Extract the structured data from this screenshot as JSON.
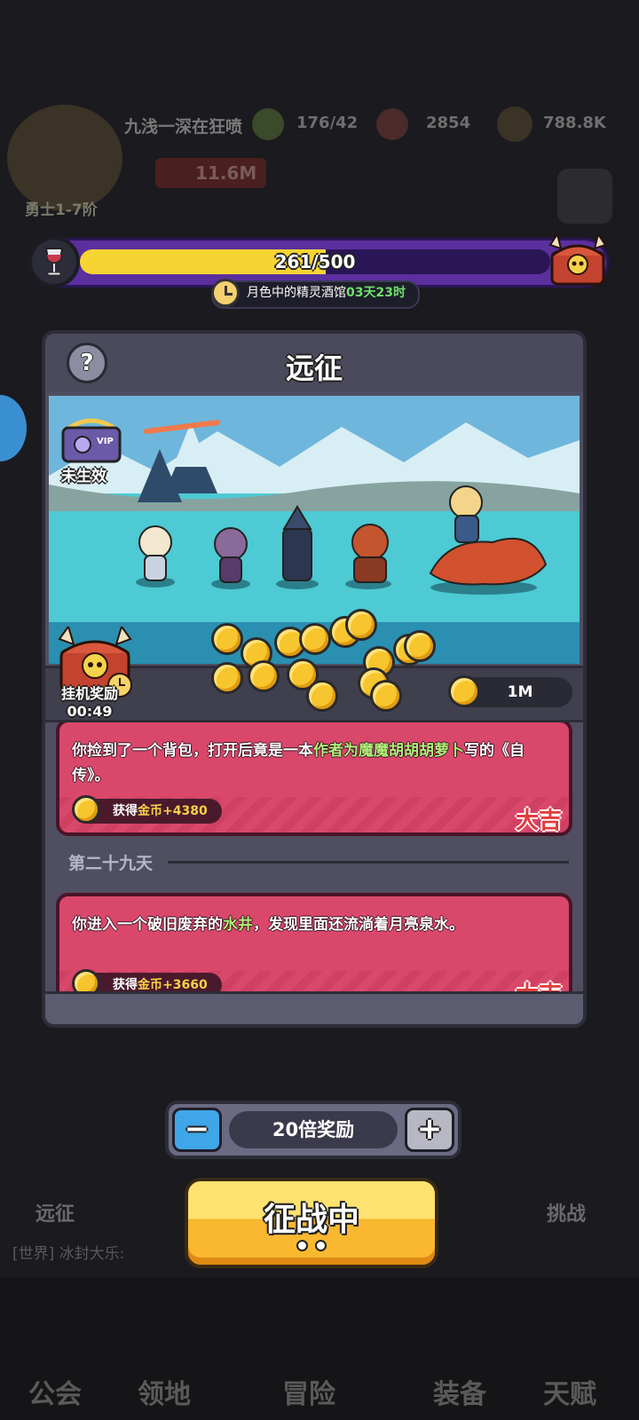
{
  "background": {
    "player_name": "九浅一深在狂喷",
    "resource_1": "176/42",
    "resource_2": "2854",
    "resource_3": "788.8K",
    "power": "11.6M",
    "rank": "勇士1-7阶",
    "side_left_label": "远征",
    "side_right_label": "挑战",
    "chat_text": "[世界] 冰封大乐:",
    "tabs": [
      "公会",
      "领地",
      "冒险",
      "装备",
      "天赋"
    ]
  },
  "event": {
    "progress_text": "261/500",
    "progress_fraction": 0.522,
    "timer_name": "月色中的精灵酒馆",
    "timer_countdown": "03天23时",
    "wine_icon": "wine-glass-icon",
    "chest_icon": "skull-chest-icon"
  },
  "dialog": {
    "title": "远征",
    "help_label": "?",
    "vip_status": "未生效",
    "vip_tag": "VIP",
    "idle_reward_label": "挂机奖励",
    "idle_reward_time": "00:49",
    "gold_amount": "1M",
    "log": [
      {
        "text_before": "你捡到了一个背包，打开后竟是一本",
        "text_highlight": "作者为魔魔胡胡胡萝卜",
        "text_after": "写的《自传》。",
        "reward_label": "获得",
        "reward_value": "金币+4380",
        "luck": "大吉"
      },
      {
        "day": "第二十九天",
        "text_before": "你进入一个破旧废弃的",
        "text_highlight": "水井",
        "text_after": "，发现里面还流淌着月亮泉水。",
        "reward_label": "获得",
        "reward_value": "金币+3660",
        "luck": "大吉"
      }
    ]
  },
  "multiplier": {
    "minus_label": "−",
    "plus_label": "+",
    "label": "20倍奖励"
  },
  "battle_button": {
    "label": "征战中"
  },
  "colors": {
    "event_purple": "#5b2f9e",
    "progress_yellow": "#f6d432",
    "card_red": "#d9486b",
    "button_gold": "#f9b830",
    "highlight_green": "#aef07a"
  }
}
